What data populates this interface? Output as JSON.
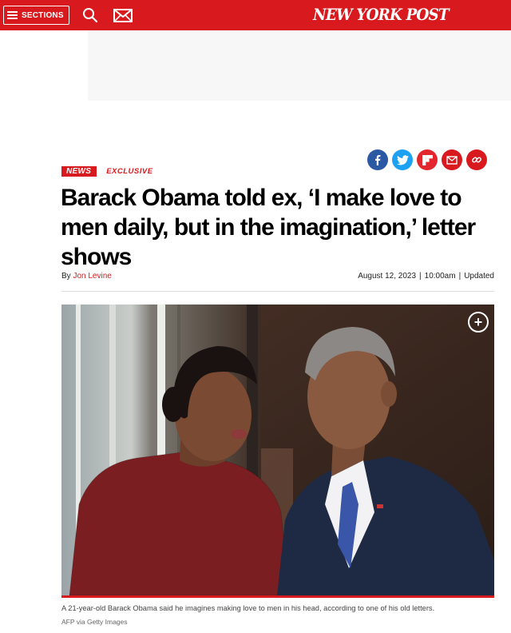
{
  "header": {
    "sections_label": "SECTIONS",
    "logo": "NEW YORK POST",
    "bar_color": "#d8191d",
    "icons": [
      "hamburger-icon",
      "search-icon",
      "mail-icon"
    ]
  },
  "share": {
    "icons": [
      "facebook-icon",
      "twitter-icon",
      "flipboard-icon",
      "email-icon",
      "link-icon"
    ],
    "colors": {
      "facebook": "#2b58a3",
      "twitter": "#1da1f2",
      "flipboard": "#e3262d",
      "email": "#d8191d",
      "link": "#d8191d"
    }
  },
  "article": {
    "tag_primary": "NEWS",
    "tag_secondary": "EXCLUSIVE",
    "headline": "Barack Obama told ex, ‘I make love to men daily, but in the imagination,’ letter shows",
    "byline_prefix": "By",
    "author": "Jon Levine",
    "date": "August 12, 2023",
    "time": "10:00am",
    "updated_label": "Updated",
    "caption": "A 21-year-old Barack Obama said he imagines making love to men in his head, according to one of his old letters.",
    "credit": "AFP via Getty Images"
  }
}
